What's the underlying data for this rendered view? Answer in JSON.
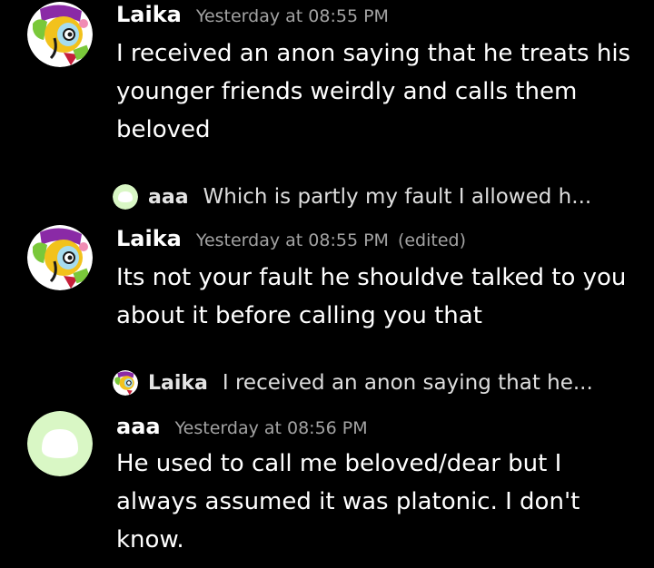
{
  "colors": {
    "background": "#000000",
    "text": "#ffffff",
    "muted": "#a3a3a3",
    "aaa_avatar": "#d9f7c5"
  },
  "messages": [
    {
      "author": "Laika",
      "timestamp": "Yesterday at 08:55 PM",
      "avatar_icon": "laika-character-avatar-icon",
      "body": "I received an anon saying that he treats his younger friends weirdly and calls them beloved"
    },
    {
      "author": "Laika",
      "timestamp": "Yesterday at 08:55 PM",
      "edited": "(edited)",
      "avatar_icon": "laika-character-avatar-icon",
      "reply": {
        "author": "aaa",
        "text": "Which is partly my fault I allowed h...",
        "avatar_icon": "aaa-avatar-icon"
      },
      "body": "Its not your fault he shouldve talked to you about it before calling you that"
    },
    {
      "author": "aaa",
      "timestamp": "Yesterday at 08:56 PM",
      "avatar_icon": "aaa-avatar-icon",
      "reply": {
        "author": "Laika",
        "text": "I received an anon saying that he...",
        "avatar_icon": "laika-character-avatar-icon"
      },
      "body": "He used to call me beloved/dear but I always assumed it was platonic. I don't know."
    }
  ]
}
